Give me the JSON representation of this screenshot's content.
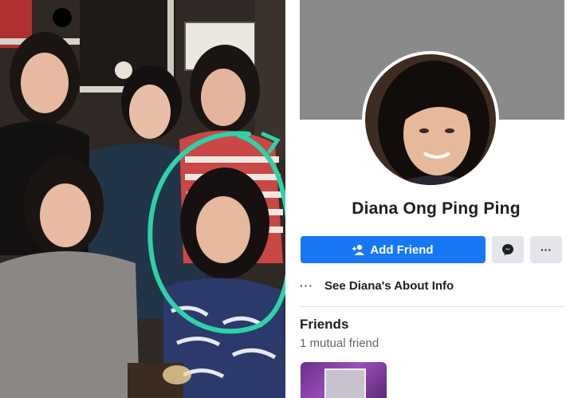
{
  "photo": {
    "highlight_color": "#2fd1a7"
  },
  "profile": {
    "name": "Diana Ong Ping Ping",
    "add_friend_label": "Add Friend",
    "add_friend_icon": "person-add-icon",
    "messenger_icon": "messenger-icon",
    "more_label": "···",
    "about_dots": "···",
    "about_label": "See Diana's About Info",
    "friends_title": "Friends",
    "mutual_friends": "1 mutual friend",
    "colors": {
      "primary_button": "#1877f2",
      "secondary_button": "#e4e6eb",
      "cover": "#8a8a8a"
    }
  }
}
